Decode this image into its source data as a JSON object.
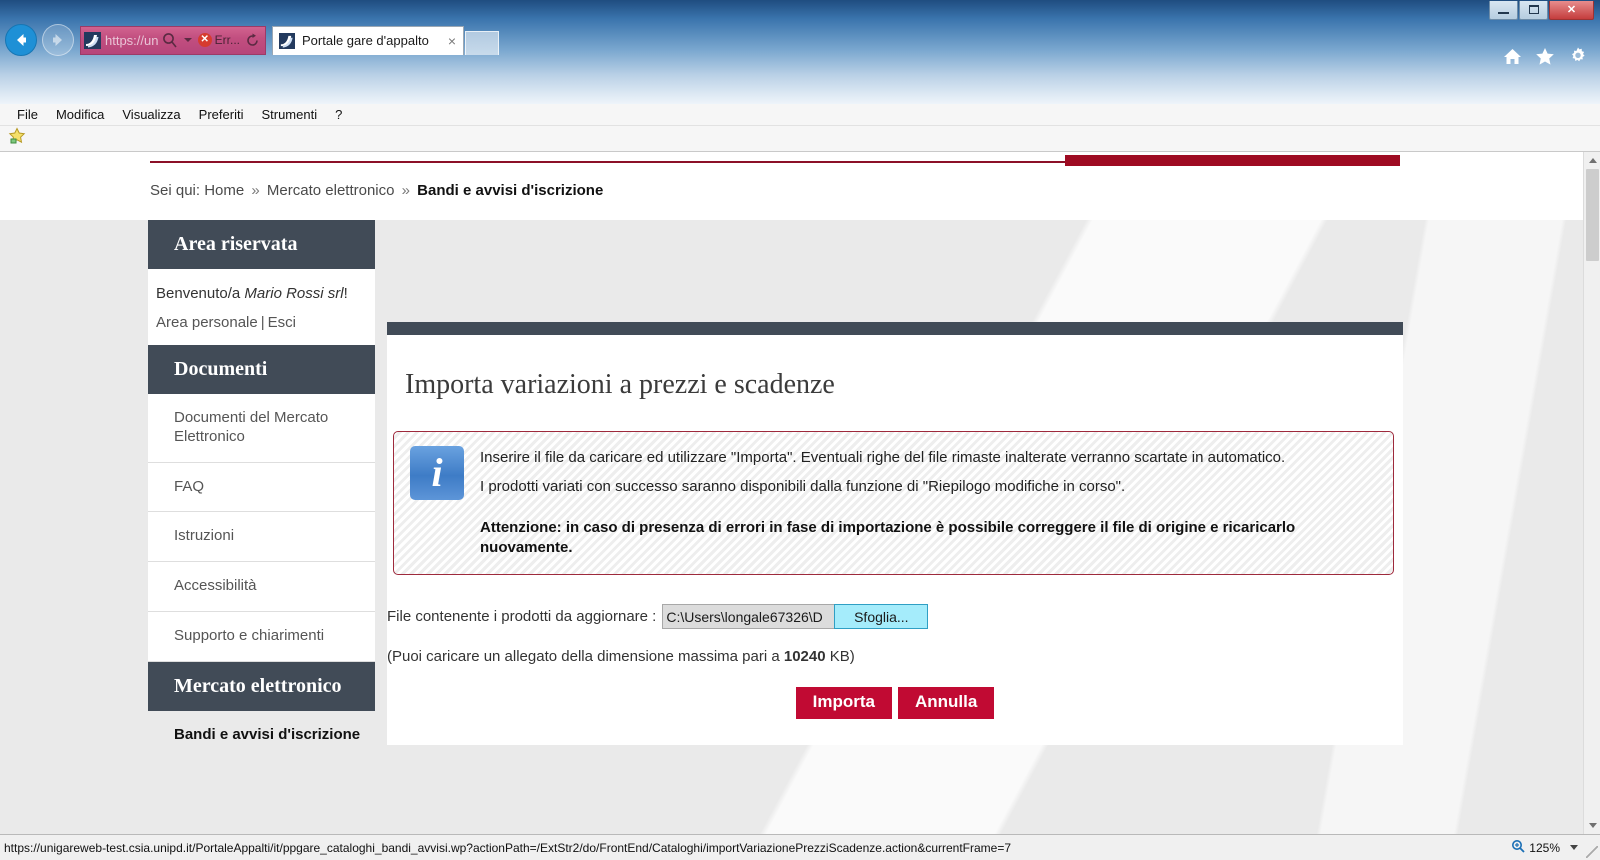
{
  "browser": {
    "window_controls": {
      "minimize": "minimize-button",
      "maximize": "maximize-button",
      "close": "close-button"
    },
    "address_bar": {
      "value": "https://uni...",
      "search_icon": "search-icon",
      "error_label": "Err...",
      "refresh_icon": "refresh-icon"
    },
    "tab": {
      "title": "Portale gare d'appalto",
      "close": "×"
    },
    "menu": [
      "File",
      "Modifica",
      "Visualizza",
      "Preferiti",
      "Strumenti",
      "?"
    ],
    "tools": {
      "home": "home-icon",
      "favorites": "favorites-icon",
      "settings": "settings-icon"
    }
  },
  "statusbar": {
    "url": "https://unigareweb-test.csia.unipd.it/PortaleAppalti/it/ppgare_cataloghi_bandi_avvisi.wp?actionPath=/ExtStr2/do/FrontEnd/Cataloghi/importVariazionePrezziScadenze.action&currentFrame=7",
    "zoom": "125%"
  },
  "breadcrumb": {
    "prefix": "Sei qui:",
    "items": [
      "Home",
      "Mercato elettronico"
    ],
    "separator": "»",
    "current": "Bandi e avvisi d'iscrizione"
  },
  "sidebar": {
    "reserved_area": {
      "title": "Area riservata",
      "welcome_prefix": "Benvenuto/a",
      "user": "Mario Rossi srl",
      "welcome_suffix": "!",
      "personal_area": "Area personale",
      "divider": "|",
      "logout": "Esci"
    },
    "documents": {
      "title": "Documenti",
      "items": [
        "Documenti del Mercato Elettronico",
        "FAQ",
        "Istruzioni",
        "Accessibilità",
        "Supporto e chiarimenti"
      ]
    },
    "marketplace": {
      "title": "Mercato elettronico",
      "items": [
        "Bandi e avvisi d'iscrizione"
      ]
    }
  },
  "main": {
    "title": "Importa variazioni a prezzi e scadenze",
    "info": {
      "icon": "info-icon",
      "line1": "Inserire il file da caricare ed utilizzare \"Importa\". Eventuali righe del file rimaste inalterate verranno scartate in automatico.",
      "line2": "I prodotti variati con successo saranno disponibili dalla funzione di \"Riepilogo modifiche in corso\".",
      "warning": "Attenzione: in caso di presenza di errori in fase di importazione è possibile correggere il file di origine e ricaricarlo nuovamente."
    },
    "file_field": {
      "label": "File contenente i prodotti da aggiornare :",
      "value": "C:\\Users\\longale67326\\D",
      "browse_button": "Sfoglia..."
    },
    "hint": {
      "prefix": "(Puoi caricare un allegato della dimensione massima pari a",
      "size": "10240",
      "suffix": "KB)"
    },
    "buttons": {
      "submit": "Importa",
      "cancel": "Annulla"
    }
  },
  "colors": {
    "accent_red": "#c10a33",
    "dark_red": "#9e0b22",
    "panel_header": "#414b57",
    "page_bg": "#eaeaea",
    "info_border": "#9e2a3c",
    "browse_btn": "#a5ecfb"
  }
}
